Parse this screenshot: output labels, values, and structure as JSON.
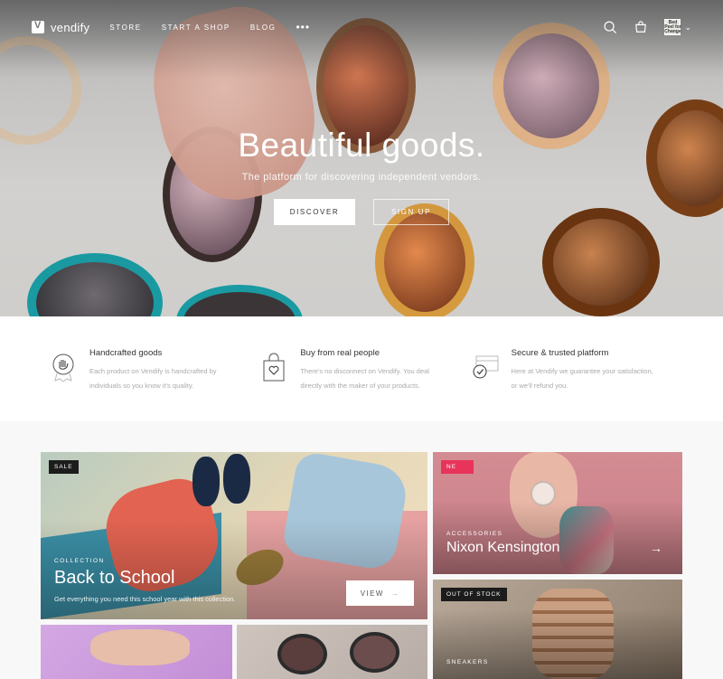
{
  "nav": {
    "brand": "vendify",
    "links": [
      "STORE",
      "START A SHOP",
      "BLOG"
    ],
    "more": "•••",
    "avatar_text": "Bed Peel for Change"
  },
  "hero": {
    "title": "Beautiful goods.",
    "subtitle": "The platform for discovering independent vendors.",
    "primary_button": "DISCOVER",
    "secondary_button": "SIGN UP"
  },
  "features": [
    {
      "title": "Handcrafted goods",
      "desc": "Each product on Vendify is handcrafted by individuals so you know it's quality.",
      "icon": "badge-hand-icon"
    },
    {
      "title": "Buy from real people",
      "desc": "There's no disconnect on Vendify. You deal directly with the maker of your products.",
      "icon": "bag-heart-icon"
    },
    {
      "title": "Secure & trusted platform",
      "desc": "Here at Vendify we guarantee your satisfaction, or we'll refund you.",
      "icon": "card-shield-icon"
    }
  ],
  "collections": {
    "big": {
      "badge": "SALE",
      "label": "COLLECTION",
      "title": "Back to School",
      "desc": "Get everything you need this school year with this collection.",
      "button": "VIEW",
      "button_arrow": "→"
    },
    "top_right": {
      "badge": "NE",
      "label": "ACCESSORIES",
      "title": "Nixon Kensington",
      "arrow": "→"
    },
    "bottom_right": {
      "badge": "OUT OF STOCK",
      "label": "SNEAKERS"
    }
  },
  "colors": {
    "accent_new": "#e8345a",
    "badge_dark": "#1c1c1c"
  }
}
